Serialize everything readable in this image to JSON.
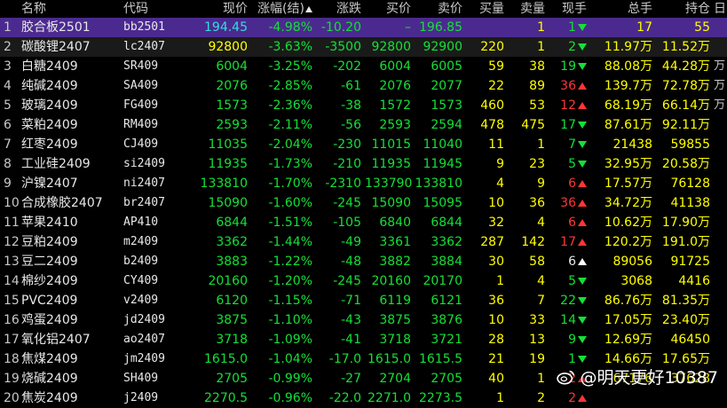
{
  "columns": [
    "名称",
    "代码",
    "现价",
    "涨幅(结)",
    "涨跌",
    "买价",
    "卖价",
    "买量",
    "卖量",
    "现手",
    "总手",
    "持仓",
    "日"
  ],
  "side_tags": [
    "万",
    "万",
    "万"
  ],
  "rows": [
    {
      "idx": "1",
      "name": "胶合板2501",
      "code": "bb2501",
      "price": "194.45",
      "pct": "-4.98%",
      "chg": "-10.20",
      "bid": "–",
      "ask": "196.85",
      "bidv": "",
      "askv": "1",
      "hand": "1",
      "dir": "down",
      "vol": "17",
      "oi": "55"
    },
    {
      "idx": "2",
      "name": "碳酸锂2407",
      "code": "lc2407",
      "price": "92800",
      "pct": "-3.63%",
      "chg": "-3500",
      "bid": "92800",
      "ask": "92900",
      "bidv": "220",
      "askv": "1",
      "hand": "2",
      "dir": "down",
      "vol": "11.97万",
      "oi": "11.52万"
    },
    {
      "idx": "3",
      "name": "白糖2409",
      "code": "SR409",
      "price": "6004",
      "pct": "-3.25%",
      "chg": "-202",
      "bid": "6004",
      "ask": "6005",
      "bidv": "59",
      "askv": "38",
      "hand": "19",
      "dir": "down",
      "vol": "88.08万",
      "oi": "44.28万"
    },
    {
      "idx": "4",
      "name": "纯碱2409",
      "code": "SA409",
      "price": "2076",
      "pct": "-2.85%",
      "chg": "-61",
      "bid": "2076",
      "ask": "2077",
      "bidv": "22",
      "askv": "89",
      "hand": "36",
      "dir": "up",
      "vol": "139.7万",
      "oi": "72.78万"
    },
    {
      "idx": "5",
      "name": "玻璃2409",
      "code": "FG409",
      "price": "1573",
      "pct": "-2.36%",
      "chg": "-38",
      "bid": "1572",
      "ask": "1573",
      "bidv": "460",
      "askv": "53",
      "hand": "12",
      "dir": "up",
      "vol": "68.19万",
      "oi": "66.14万"
    },
    {
      "idx": "6",
      "name": "菜粕2409",
      "code": "RM409",
      "price": "2593",
      "pct": "-2.11%",
      "chg": "-56",
      "bid": "2593",
      "ask": "2594",
      "bidv": "478",
      "askv": "475",
      "hand": "17",
      "dir": "down",
      "vol": "87.61万",
      "oi": "92.11万"
    },
    {
      "idx": "7",
      "name": "红枣2409",
      "code": "CJ409",
      "price": "11035",
      "pct": "-2.04%",
      "chg": "-230",
      "bid": "11015",
      "ask": "11040",
      "bidv": "11",
      "askv": "1",
      "hand": "7",
      "dir": "down",
      "vol": "21438",
      "oi": "59855"
    },
    {
      "idx": "8",
      "name": "工业硅2409",
      "code": "si2409",
      "price": "11935",
      "pct": "-1.73%",
      "chg": "-210",
      "bid": "11935",
      "ask": "11945",
      "bidv": "9",
      "askv": "23",
      "hand": "5",
      "dir": "down",
      "vol": "32.95万",
      "oi": "20.58万"
    },
    {
      "idx": "9",
      "name": "沪镍2407",
      "code": "ni2407",
      "price": "133810",
      "pct": "-1.70%",
      "chg": "-2310",
      "bid": "133790",
      "ask": "133810",
      "bidv": "4",
      "askv": "9",
      "hand": "6",
      "dir": "up",
      "vol": "17.57万",
      "oi": "76128"
    },
    {
      "idx": "10",
      "name": "合成橡胶2407",
      "code": "br2407",
      "price": "15090",
      "pct": "-1.60%",
      "chg": "-245",
      "bid": "15090",
      "ask": "15095",
      "bidv": "10",
      "askv": "36",
      "hand": "36",
      "dir": "up",
      "vol": "34.72万",
      "oi": "41138"
    },
    {
      "idx": "11",
      "name": "苹果2410",
      "code": "AP410",
      "price": "6844",
      "pct": "-1.51%",
      "chg": "-105",
      "bid": "6840",
      "ask": "6844",
      "bidv": "32",
      "askv": "4",
      "hand": "6",
      "dir": "up",
      "vol": "10.62万",
      "oi": "17.90万"
    },
    {
      "idx": "12",
      "name": "豆粕2409",
      "code": "m2409",
      "price": "3362",
      "pct": "-1.44%",
      "chg": "-49",
      "bid": "3361",
      "ask": "3362",
      "bidv": "287",
      "askv": "142",
      "hand": "17",
      "dir": "up",
      "vol": "120.2万",
      "oi": "191.0万"
    },
    {
      "idx": "13",
      "name": "豆二2409",
      "code": "b2409",
      "price": "3883",
      "pct": "-1.22%",
      "chg": "-48",
      "bid": "3882",
      "ask": "3884",
      "bidv": "30",
      "askv": "58",
      "hand": "6",
      "dir": "upw",
      "vol": "89056",
      "oi": "91725"
    },
    {
      "idx": "14",
      "name": "棉纱2409",
      "code": "CY409",
      "price": "20160",
      "pct": "-1.20%",
      "chg": "-245",
      "bid": "20160",
      "ask": "20170",
      "bidv": "1",
      "askv": "4",
      "hand": "5",
      "dir": "down",
      "vol": "3068",
      "oi": "4416"
    },
    {
      "idx": "15",
      "name": "PVC2409",
      "code": "v2409",
      "price": "6120",
      "pct": "-1.15%",
      "chg": "-71",
      "bid": "6119",
      "ask": "6121",
      "bidv": "36",
      "askv": "7",
      "hand": "22",
      "dir": "down",
      "vol": "86.76万",
      "oi": "81.35万"
    },
    {
      "idx": "16",
      "name": "鸡蛋2409",
      "code": "jd2409",
      "price": "3875",
      "pct": "-1.10%",
      "chg": "-43",
      "bid": "3875",
      "ask": "3876",
      "bidv": "10",
      "askv": "33",
      "hand": "14",
      "dir": "down",
      "vol": "17.05万",
      "oi": "23.40万"
    },
    {
      "idx": "17",
      "name": "氧化铝2407",
      "code": "ao2407",
      "price": "3718",
      "pct": "-1.09%",
      "chg": "-41",
      "bid": "3718",
      "ask": "3721",
      "bidv": "28",
      "askv": "13",
      "hand": "9",
      "dir": "down",
      "vol": "12.69万",
      "oi": "46450"
    },
    {
      "idx": "18",
      "name": "焦煤2409",
      "code": "jm2409",
      "price": "1615.0",
      "pct": "-1.04%",
      "chg": "-17.0",
      "bid": "1615.0",
      "ask": "1615.5",
      "bidv": "21",
      "askv": "19",
      "hand": "1",
      "dir": "down",
      "vol": "14.66万",
      "oi": "17.65万"
    },
    {
      "idx": "19",
      "name": "烧碱2409",
      "code": "SH409",
      "price": "2705",
      "pct": "-0.99%",
      "chg": "-27",
      "bid": "2704",
      "ask": "2705",
      "bidv": "40",
      "askv": "1",
      "hand": "2",
      "dir": "up",
      "vol": "67176",
      "oi": "37628"
    },
    {
      "idx": "20",
      "name": "焦炭2409",
      "code": "j2409",
      "price": "2270.5",
      "pct": "-0.96%",
      "chg": "-22.0",
      "bid": "2271.0",
      "ask": "2273.5",
      "bidv": "1",
      "askv": "2",
      "hand": "2",
      "dir": "up",
      "vol": "",
      "oi": ""
    }
  ],
  "watermark": "@明天更好10387",
  "colors": {
    "up": "#ff3535",
    "down": "#15e036",
    "neutral": "#e8e8e8",
    "highlight": "#4b2a90",
    "price_yellow": "#ffff00",
    "cyan": "#33dddd"
  }
}
